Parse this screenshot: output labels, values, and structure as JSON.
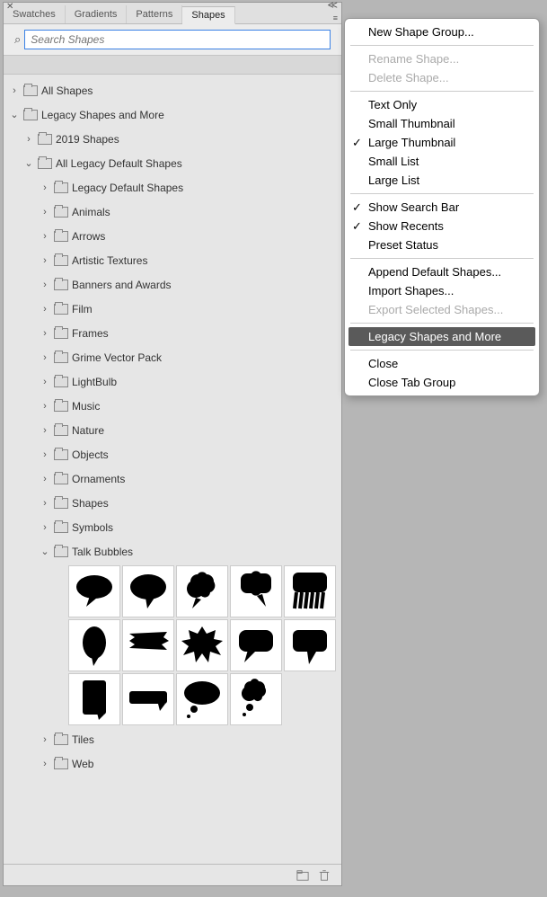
{
  "tabs": [
    "Swatches",
    "Gradients",
    "Patterns",
    "Shapes"
  ],
  "active_tab": 3,
  "search": {
    "placeholder": "Search Shapes"
  },
  "tree": [
    {
      "label": "All Shapes",
      "depth": 0,
      "open": false
    },
    {
      "label": "Legacy Shapes and More",
      "depth": 0,
      "open": true
    },
    {
      "label": "2019 Shapes",
      "depth": 1,
      "open": false
    },
    {
      "label": "All Legacy Default Shapes",
      "depth": 1,
      "open": true
    },
    {
      "label": "Legacy Default Shapes",
      "depth": 2,
      "open": false
    },
    {
      "label": "Animals",
      "depth": 2,
      "open": false
    },
    {
      "label": "Arrows",
      "depth": 2,
      "open": false
    },
    {
      "label": "Artistic Textures",
      "depth": 2,
      "open": false
    },
    {
      "label": "Banners and Awards",
      "depth": 2,
      "open": false
    },
    {
      "label": "Film",
      "depth": 2,
      "open": false
    },
    {
      "label": "Frames",
      "depth": 2,
      "open": false
    },
    {
      "label": "Grime Vector Pack",
      "depth": 2,
      "open": false
    },
    {
      "label": "LightBulb",
      "depth": 2,
      "open": false
    },
    {
      "label": "Music",
      "depth": 2,
      "open": false
    },
    {
      "label": "Nature",
      "depth": 2,
      "open": false
    },
    {
      "label": "Objects",
      "depth": 2,
      "open": false
    },
    {
      "label": "Ornaments",
      "depth": 2,
      "open": false
    },
    {
      "label": "Shapes",
      "depth": 2,
      "open": false
    },
    {
      "label": "Symbols",
      "depth": 2,
      "open": false
    },
    {
      "label": "Talk Bubbles",
      "depth": 2,
      "open": true
    },
    {
      "label": "Tiles",
      "depth": 2,
      "open": false
    },
    {
      "label": "Web",
      "depth": 2,
      "open": false
    }
  ],
  "thumbnail_count": 14,
  "menu": [
    {
      "label": "New Shape Group...",
      "type": "item"
    },
    {
      "type": "sep"
    },
    {
      "label": "Rename Shape...",
      "type": "dis"
    },
    {
      "label": "Delete Shape...",
      "type": "dis"
    },
    {
      "type": "sep"
    },
    {
      "label": "Text Only",
      "type": "item"
    },
    {
      "label": "Small Thumbnail",
      "type": "item"
    },
    {
      "label": "Large Thumbnail",
      "type": "chk"
    },
    {
      "label": "Small List",
      "type": "item"
    },
    {
      "label": "Large List",
      "type": "item"
    },
    {
      "type": "sep"
    },
    {
      "label": "Show Search Bar",
      "type": "chk"
    },
    {
      "label": "Show Recents",
      "type": "chk"
    },
    {
      "label": "Preset Status",
      "type": "item"
    },
    {
      "type": "sep"
    },
    {
      "label": "Append Default Shapes...",
      "type": "item"
    },
    {
      "label": "Import Shapes...",
      "type": "item"
    },
    {
      "label": "Export Selected Shapes...",
      "type": "dis"
    },
    {
      "type": "sep"
    },
    {
      "label": "Legacy Shapes and More",
      "type": "hl"
    },
    {
      "type": "sep"
    },
    {
      "label": "Close",
      "type": "item"
    },
    {
      "label": "Close Tab Group",
      "type": "item"
    }
  ]
}
